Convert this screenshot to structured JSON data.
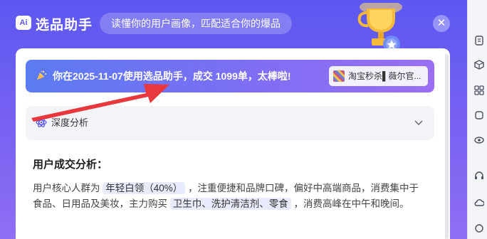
{
  "header": {
    "logo_text": "Ai",
    "title": "选品助手",
    "tagline": "读懂你的用户画像，匹配适合你的爆品",
    "close_label": "✕"
  },
  "banner": {
    "text": "你在2025-11-07使用选品助手，成交 1099单，太棒啦!",
    "store_name": "淘宝秒杀▌薇尔官..."
  },
  "accordion": {
    "label": "深度分析",
    "expanded": false
  },
  "analysis": {
    "title": "用户成交分析：",
    "p1": "用户核心人群为",
    "tag1": "年轻白领（40%）",
    "p2": "，注重便捷和品牌口碑，偏好中高端商品，消费集中于食品、日用品及美妆，主力购买",
    "tag2": "卫生巾、洗护清洁剂、零食",
    "p3": "，消费高峰在中午和晚间。"
  },
  "rail_icons": [
    "file-icon",
    "cube-icon",
    "grid-icon",
    "box-icon",
    "eye-icon",
    "headset-icon",
    "cloud-icon",
    "link-icon"
  ],
  "colors": {
    "brand": "#5b58f0",
    "banner_start": "#5b7bf2",
    "banner_end": "#9a6ff5",
    "arrow": "#e8383d"
  }
}
